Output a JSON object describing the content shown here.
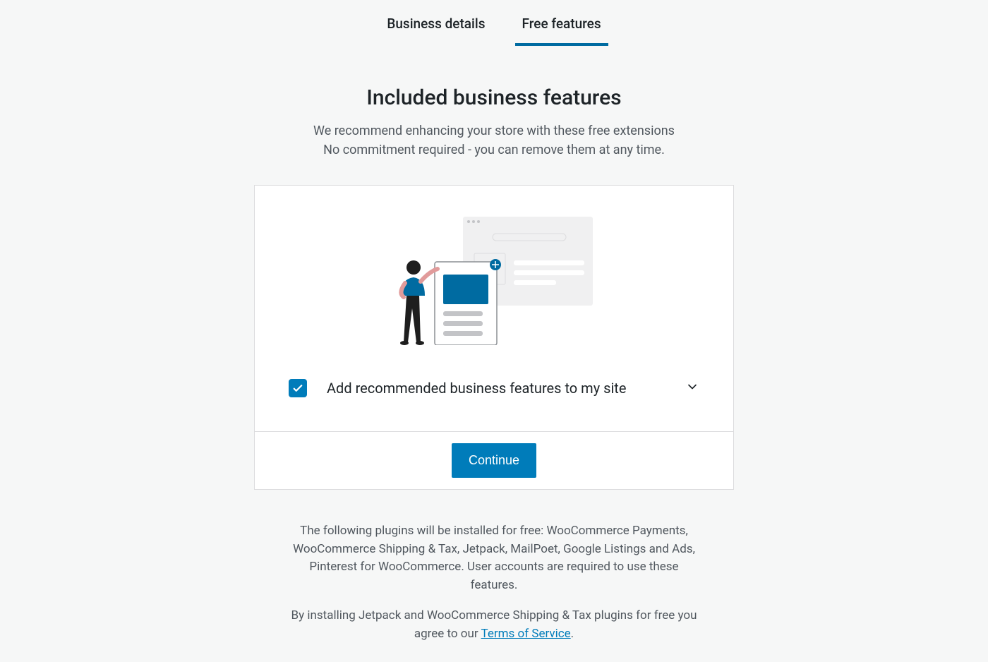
{
  "tabs": {
    "business_details": "Business details",
    "free_features": "Free features"
  },
  "heading": {
    "title": "Included business features",
    "subtitle_line1": "We recommend enhancing your store with these free extensions",
    "subtitle_line2": "No commitment required - you can remove them at any time."
  },
  "checkbox": {
    "label": "Add recommended business features to my site",
    "checked": true
  },
  "continue_button": "Continue",
  "footer": {
    "plugins_notice": "The following plugins will be installed for free: WooCommerce Payments, WooCommerce Shipping & Tax, Jetpack, MailPoet, Google Listings and Ads, Pinterest for WooCommerce. User accounts are required to use these features.",
    "tos_prefix": "By installing Jetpack and WooCommerce Shipping & Tax plugins for free you agree to our ",
    "tos_link": "Terms of Service",
    "tos_suffix": "."
  }
}
